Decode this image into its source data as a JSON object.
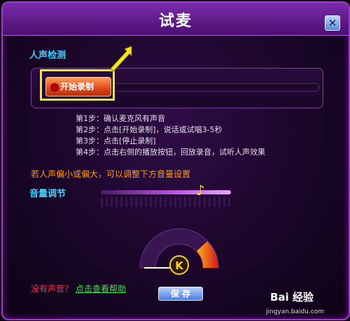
{
  "window": {
    "title": "试麦",
    "close_icon": "close-icon",
    "close_glyph": "✕"
  },
  "detection": {
    "section_label": "人声检测",
    "record_button": "开始录制"
  },
  "steps": [
    "第1步：确认麦克风有声音",
    "第2步：点击[开始录制]，说话或试唱3-5秒",
    "第3步：点击[停止录制]",
    "第4步：点击右侧的播放按钮，回放录音，试听人声效果"
  ],
  "hint": "若人声偏小或偏大，可以调整下方音量设置",
  "volume": {
    "section_label": "音量调节",
    "thumb_icon": "music-note-icon",
    "thumb_glyph": "♪",
    "level": 0.75
  },
  "gauge": {
    "badge_text": "K"
  },
  "help": {
    "question": "没有声音？",
    "link": "点击查看帮助"
  },
  "footer": {
    "save_button": "保 存"
  },
  "watermark": {
    "brand": "Bai 经验",
    "url": "jingyan.baidu.com"
  },
  "colors": {
    "accent": "#3cd0ff",
    "window_bg": "#1a0628",
    "highlight": "#f6ea1e",
    "record_button": "#e0461a",
    "hint": "#ff9a1e",
    "help_link": "#3ee04a",
    "help_question": "#ff3050"
  }
}
